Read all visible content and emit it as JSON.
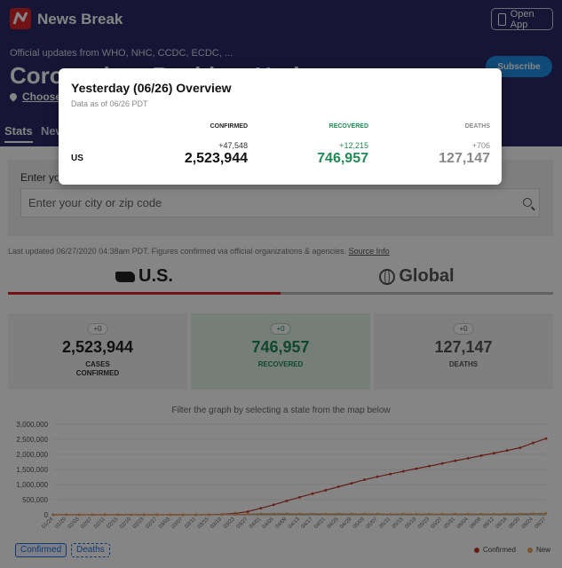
{
  "header": {
    "brand": "News Break",
    "open_app_label": "Open App"
  },
  "hero": {
    "subtitle": "Official updates from WHO, NHC, CCDC, ECDC, ...",
    "title": "Coronavirus Realtime Updates",
    "choose_location": "Choose",
    "subscribe_label": "Subscribe"
  },
  "tabs": [
    {
      "label": "Stats"
    },
    {
      "label": "News"
    }
  ],
  "search": {
    "label": "Enter your city or zip code",
    "placeholder": "Enter your city or zip code"
  },
  "updated": {
    "text": "Last updated 06/27/2020 04:38am PDT. Figures confirmed via official organizations & agencies.",
    "source_label": "Source Info"
  },
  "region_tabs": {
    "us": "U.S.",
    "global": "Global"
  },
  "stats": {
    "cases": {
      "badge": "+0",
      "value": "2,523,944",
      "label_1": "CASES",
      "label_2": "CONFIRMED"
    },
    "recovered": {
      "badge": "+0",
      "value": "746,957",
      "label": "RECOVERED"
    },
    "deaths": {
      "badge": "+0",
      "value": "127,147",
      "label": "DEATHS"
    }
  },
  "graph_hint": "Filter the graph by selecting a state from the map below",
  "buttons": {
    "confirmed": "Confirmed",
    "deaths": "Deaths"
  },
  "legend": {
    "confirmed": "Confirmed",
    "new": "New"
  },
  "colors": {
    "brand_bg": "#2b2a66",
    "accent_red": "#d8232a",
    "recovered_green": "#218a55",
    "confirmed_line": "#c0392b",
    "new_line": "#e6a15c"
  },
  "chart_data": {
    "type": "line",
    "y_ticks": [
      "3,000,000",
      "2,500,000",
      "2,000,000",
      "1,500,000",
      "1,000,000",
      "500,000",
      "0"
    ],
    "ylim": [
      0,
      3000000
    ],
    "x_ticks": [
      "01/24",
      "01/29",
      "02/03",
      "02/07",
      "02/11",
      "02/15",
      "02/19",
      "02/23",
      "02/27",
      "03/03",
      "03/07",
      "03/11",
      "03/15",
      "03/19",
      "03/23",
      "03/27",
      "04/01",
      "04/05",
      "04/09",
      "04/13",
      "04/17",
      "04/21",
      "04/25",
      "04/29",
      "05/03",
      "05/07",
      "05/11",
      "05/15",
      "05/19",
      "05/23",
      "05/27",
      "05/31",
      "06/04",
      "06/08",
      "06/12",
      "06/16",
      "06/20",
      "06/24",
      "06/27"
    ],
    "series": [
      {
        "name": "Confirmed",
        "values": [
          0,
          0,
          0,
          0,
          0,
          0,
          0,
          0,
          0,
          0,
          200,
          1300,
          3500,
          14000,
          43000,
          104000,
          215000,
          330000,
          460000,
          580000,
          700000,
          810000,
          930000,
          1040000,
          1160000,
          1260000,
          1350000,
          1440000,
          1530000,
          1610000,
          1700000,
          1790000,
          1870000,
          1960000,
          2040000,
          2130000,
          2220000,
          2380000,
          2523944
        ]
      },
      {
        "name": "New",
        "values": [
          0,
          0,
          0,
          0,
          0,
          0,
          0,
          0,
          0,
          0,
          50,
          300,
          800,
          5000,
          10000,
          18000,
          30000,
          30000,
          32000,
          28000,
          30000,
          27000,
          30000,
          27000,
          25000,
          25000,
          20000,
          24000,
          20000,
          22000,
          20000,
          22000,
          21000,
          22000,
          23000,
          25000,
          30000,
          38000,
          44000
        ]
      }
    ]
  },
  "modal": {
    "title": "Yesterday (06/26) Overview",
    "subtitle": "Data as of 06/26 PDT",
    "headers": {
      "confirmed": "CONFIRMED",
      "recovered": "RECOVERED",
      "deaths": "DEATHS"
    },
    "row": {
      "label": "US",
      "confirmed_delta": "+47,548",
      "confirmed": "2,523,944",
      "recovered_delta": "+12,215",
      "recovered": "746,957",
      "deaths_delta": "+706",
      "deaths": "127,147"
    }
  }
}
